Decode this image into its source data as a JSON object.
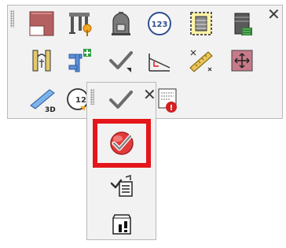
{
  "toolbar": {
    "close_symbol": "✕",
    "row1": [
      "surface-material-icon",
      "structure-transfer-icon",
      "tank-icon",
      "numbering-123-icon",
      "dashed-frame-building-icon",
      "tower-texture-icon"
    ],
    "row2": [
      "columns-gate-icon",
      "add-connection-icon",
      "check-icon",
      "slope-profile-icon",
      "measure-ruler-icon",
      "move-view-icon"
    ],
    "row3": [
      "view-3d-icon",
      "numbering-icon-partial"
    ]
  },
  "flyout": {
    "close_symbol": "✕",
    "items": [
      "check-icon",
      "check-circle-icon",
      "check-list-icon",
      "warning-block-icon"
    ],
    "side_icon": "model-error-icon",
    "highlighted_item": "check-circle-icon"
  },
  "colors": {
    "highlight": "#e5161b",
    "panel_bg": "#f2f2f2",
    "panel_border": "#b9b9b9"
  }
}
